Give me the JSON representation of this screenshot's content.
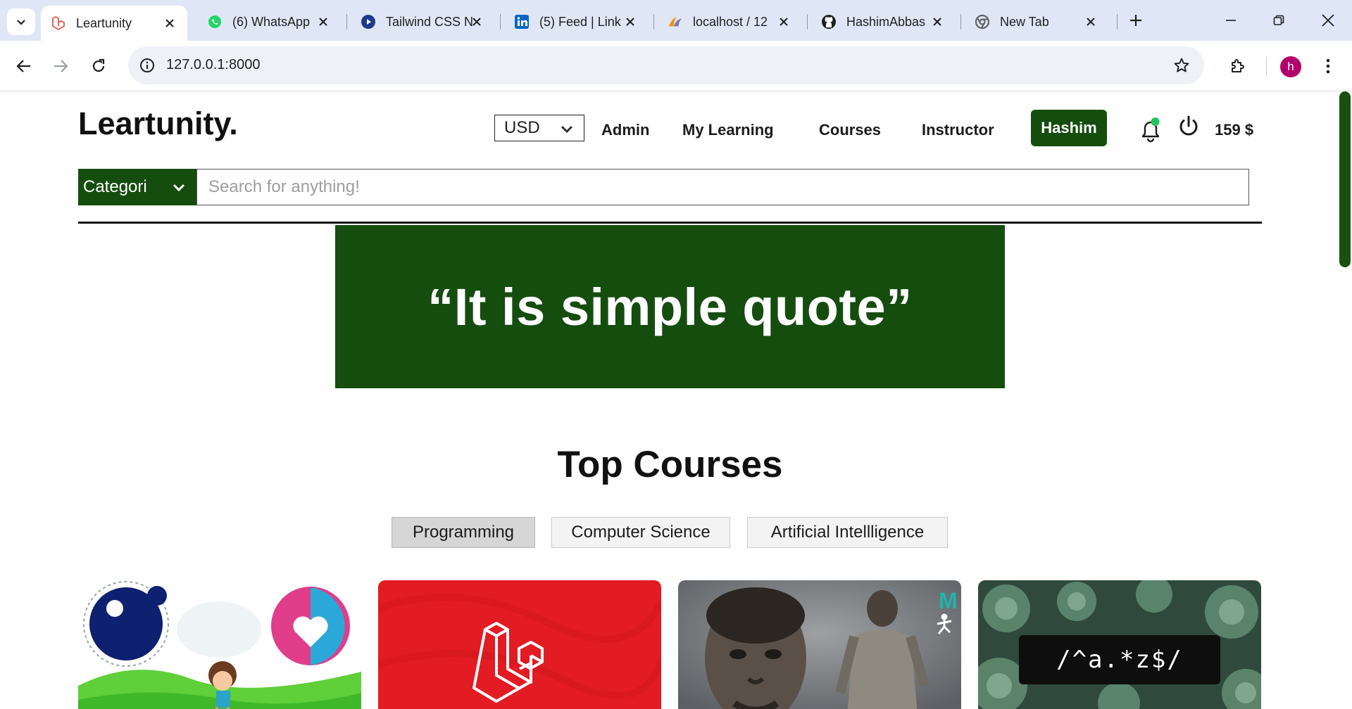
{
  "browser": {
    "tabs": [
      {
        "title": "Leartunity",
        "icon": "laravel-icon",
        "active": true
      },
      {
        "title": "(6) WhatsApp",
        "icon": "whatsapp-icon",
        "active": false
      },
      {
        "title": "Tailwind CSS N",
        "icon": "tailwind-icon",
        "active": false
      },
      {
        "title": "(5) Feed | Link",
        "icon": "linkedin-icon",
        "active": false
      },
      {
        "title": "localhost / 12",
        "icon": "phpmyadmin-icon",
        "active": false
      },
      {
        "title": "HashimAbbas",
        "icon": "github-icon",
        "active": false
      },
      {
        "title": "New Tab",
        "icon": "chrome-icon",
        "active": false
      }
    ],
    "url": "127.0.0.1:8000",
    "profile_initial": "h"
  },
  "header": {
    "logo": "Leartunity.",
    "currency": "USD",
    "nav": [
      "Admin",
      "My Learning",
      "Courses",
      "Instructor"
    ],
    "user_name": "Hashim",
    "balance": "159 $",
    "notification_dot_color": "#22c55e"
  },
  "search": {
    "category_label": "Categori",
    "placeholder": "Search for anything!"
  },
  "hero": {
    "quote": "“It is simple quote”"
  },
  "top_courses": {
    "title": "Top Courses",
    "filters": [
      "Programming",
      "Computer Science",
      "Artificial Intellligence"
    ],
    "active_filter": "Programming",
    "cards": [
      {
        "image": "illustration-cartoon-thumbnail"
      },
      {
        "image": "laravel-logo-thumbnail"
      },
      {
        "image": "3d-sculpt-thumbnail"
      },
      {
        "image": "regex-thumbnail",
        "caption": "/^a.*z$/"
      }
    ]
  },
  "colors": {
    "brand_green": "#154d0f",
    "tabbar": "#dfe7f6",
    "laravel_red": "#e31b23"
  }
}
